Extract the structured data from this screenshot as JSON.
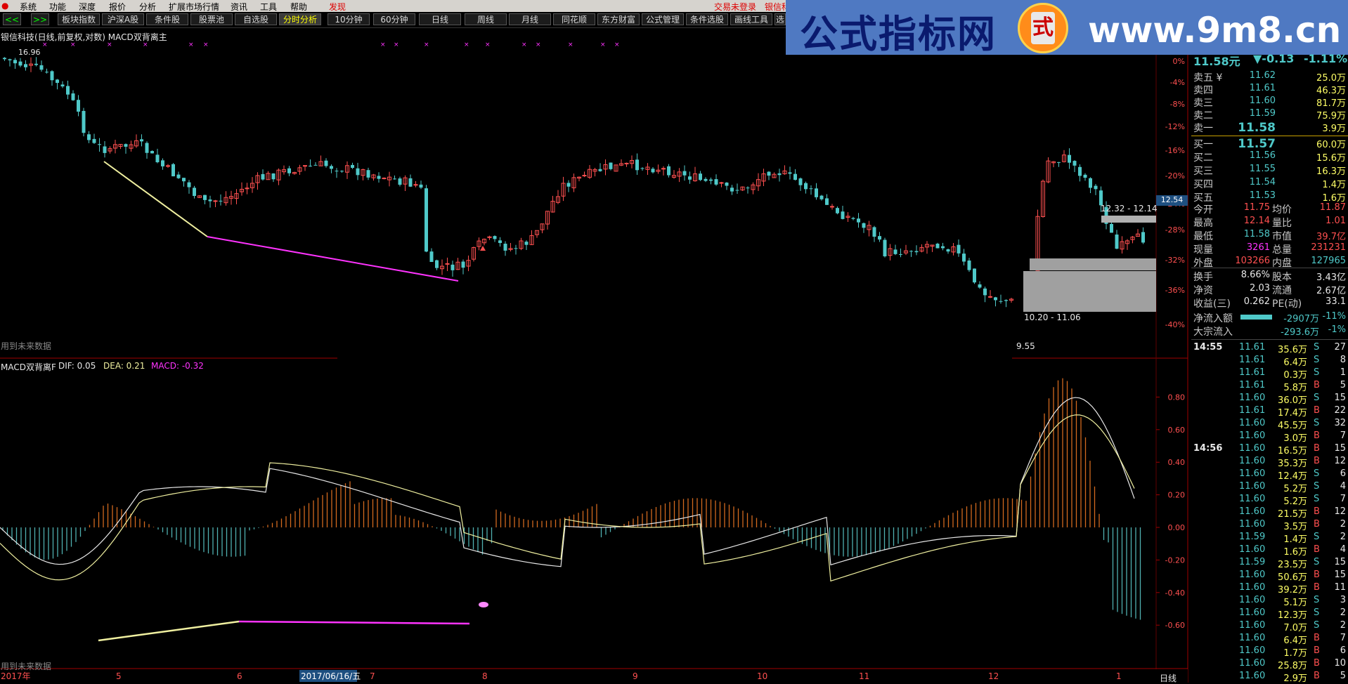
{
  "menubar": {
    "items": [
      "系统",
      "功能",
      "深度",
      "报价",
      "分析",
      "扩展市场行情",
      "资讯",
      "工具",
      "帮助"
    ],
    "discover": "发现",
    "login": "交易未登录",
    "stock_short": "银信科"
  },
  "toolbar": {
    "prev": "<<",
    "next": ">>",
    "tabs": [
      "板块指数",
      "沪深A股",
      "条件股",
      "股票池",
      "自选股",
      "分时分析",
      "10分钟",
      "60分钟",
      "日线",
      "周线",
      "月线",
      "同花顺",
      "东方财富",
      "公式管理",
      "条件选股",
      "画线工具",
      "选"
    ],
    "active": "分时分析"
  },
  "banner": {
    "title": "公式指标网",
    "url": "www.9m8.cn",
    "logo_char": "式"
  },
  "main_panel": {
    "title": "银信科技(日线,前复权,对数) MACD双背离主",
    "top_price_label": "16.96",
    "future_data_note": "用到未来数据",
    "bottom_price_label": "9.55",
    "range_label_1": "12.32 - 12.14",
    "range_label_2": "10.20 - 11.06",
    "current_price_tag": "12.54"
  },
  "macd_panel": {
    "title": "MACD双背离F",
    "dif_label": "DIF: 0.05",
    "dea_label": "DEA: 0.21",
    "macd_label": "MACD: -0.32",
    "future_data_note": "用到未来数据",
    "y_ticks": [
      "0.80",
      "0.60",
      "0.40",
      "0.20",
      "0.00",
      "-0.20",
      "-0.40",
      "-0.60"
    ]
  },
  "price_axis": {
    "ticks": [
      "0%",
      "-4%",
      "-8%",
      "-12%",
      "-16%",
      "-20%",
      "-24%",
      "-28%",
      "-32%",
      "-36%",
      "-40%"
    ]
  },
  "x_axis": {
    "labels": [
      "2017年",
      "5",
      "6",
      "2017/06/16/五",
      "7",
      "8",
      "9",
      "10",
      "11",
      "12",
      "1"
    ],
    "period": "日线"
  },
  "quote": {
    "header_price": "11.58元",
    "header_change": "▼-0.13",
    "header_pct": "-1.11%",
    "asks": [
      {
        "label": "卖五 ¥",
        "price": "11.62",
        "vol": "25.0万"
      },
      {
        "label": "卖四",
        "price": "11.61",
        "vol": "46.3万"
      },
      {
        "label": "卖三",
        "price": "11.60",
        "vol": "81.7万"
      },
      {
        "label": "卖二",
        "price": "11.59",
        "vol": "75.9万"
      },
      {
        "label": "卖一",
        "price": "11.58",
        "vol": "3.9万"
      }
    ],
    "bids": [
      {
        "label": "买一",
        "price": "11.57",
        "vol": "60.0万"
      },
      {
        "label": "买二",
        "price": "11.56",
        "vol": "15.6万"
      },
      {
        "label": "买三",
        "price": "11.55",
        "vol": "16.3万"
      },
      {
        "label": "买四",
        "price": "11.54",
        "vol": "1.4万"
      },
      {
        "label": "买五",
        "price": "11.53",
        "vol": "1.6万"
      }
    ],
    "stats": [
      {
        "l1": "今开",
        "v1": "11.75",
        "l2": "均价",
        "v2": "11.87"
      },
      {
        "l1": "最高",
        "v1": "12.14",
        "l2": "量比",
        "v2": "1.01"
      },
      {
        "l1": "最低",
        "v1": "11.58",
        "l2": "市值",
        "v2": "39.7亿"
      },
      {
        "l1": "现量",
        "v1": "3261",
        "l2": "总量",
        "v2": "231231"
      },
      {
        "l1": "外盘",
        "v1": "103266",
        "l2": "内盘",
        "v2": "127965"
      }
    ],
    "stats2": [
      {
        "l1": "换手",
        "v1": "8.66%",
        "l2": "股本",
        "v2": "3.43亿"
      },
      {
        "l1": "净资",
        "v1": "2.03",
        "l2": "流通",
        "v2": "2.67亿"
      },
      {
        "l1": "收益(三)",
        "v1": "0.262",
        "l2": "PE(动)",
        "v2": "33.1"
      }
    ],
    "flows": [
      {
        "label": "净流入额",
        "value": "-2907万",
        "pct": "-11%"
      },
      {
        "label": "大宗流入",
        "value": "-293.6万",
        "pct": "-1%"
      }
    ]
  },
  "ticks": {
    "time_1": "14:55",
    "time_2": "14:56",
    "rows": [
      {
        "price": "11.61",
        "vol": "35.6万",
        "side": "S",
        "n": "27"
      },
      {
        "price": "11.61",
        "vol": "6.4万",
        "side": "S",
        "n": "8"
      },
      {
        "price": "11.61",
        "vol": "0.3万",
        "side": "S",
        "n": "1"
      },
      {
        "price": "11.61",
        "vol": "5.8万",
        "side": "B",
        "n": "5"
      },
      {
        "price": "11.60",
        "vol": "36.0万",
        "side": "S",
        "n": "15"
      },
      {
        "price": "11.61",
        "vol": "17.4万",
        "side": "B",
        "n": "22"
      },
      {
        "price": "11.60",
        "vol": "45.5万",
        "side": "S",
        "n": "32"
      },
      {
        "price": "11.60",
        "vol": "3.0万",
        "side": "B",
        "n": "7"
      },
      {
        "price": "11.60",
        "vol": "16.5万",
        "side": "B",
        "n": "15"
      },
      {
        "price": "11.60",
        "vol": "35.3万",
        "side": "B",
        "n": "12"
      },
      {
        "price": "11.60",
        "vol": "12.4万",
        "side": "S",
        "n": "6"
      },
      {
        "price": "11.60",
        "vol": "5.2万",
        "side": "S",
        "n": "4"
      },
      {
        "price": "11.60",
        "vol": "5.2万",
        "side": "S",
        "n": "7"
      },
      {
        "price": "11.60",
        "vol": "21.5万",
        "side": "B",
        "n": "12"
      },
      {
        "price": "11.60",
        "vol": "3.5万",
        "side": "B",
        "n": "2"
      },
      {
        "price": "11.59",
        "vol": "1.4万",
        "side": "S",
        "n": "2"
      },
      {
        "price": "11.60",
        "vol": "1.6万",
        "side": "B",
        "n": "4"
      },
      {
        "price": "11.59",
        "vol": "23.5万",
        "side": "S",
        "n": "15"
      },
      {
        "price": "11.60",
        "vol": "50.6万",
        "side": "B",
        "n": "15"
      },
      {
        "price": "11.60",
        "vol": "39.2万",
        "side": "B",
        "n": "11"
      },
      {
        "price": "11.60",
        "vol": "5.1万",
        "side": "S",
        "n": "3"
      },
      {
        "price": "11.60",
        "vol": "12.3万",
        "side": "S",
        "n": "2"
      },
      {
        "price": "11.60",
        "vol": "7.0万",
        "side": "S",
        "n": "2"
      },
      {
        "price": "11.60",
        "vol": "6.4万",
        "side": "B",
        "n": "7"
      },
      {
        "price": "11.60",
        "vol": "1.7万",
        "side": "B",
        "n": "6"
      },
      {
        "price": "11.60",
        "vol": "25.8万",
        "side": "B",
        "n": "10"
      },
      {
        "price": "11.60",
        "vol": "2.9万",
        "side": "B",
        "n": "5"
      }
    ]
  },
  "colors": {
    "up": "#ff5050",
    "down": "#4fc9c9",
    "yellow_line": "#f0f0a0",
    "magenta": "#ff33ff"
  }
}
